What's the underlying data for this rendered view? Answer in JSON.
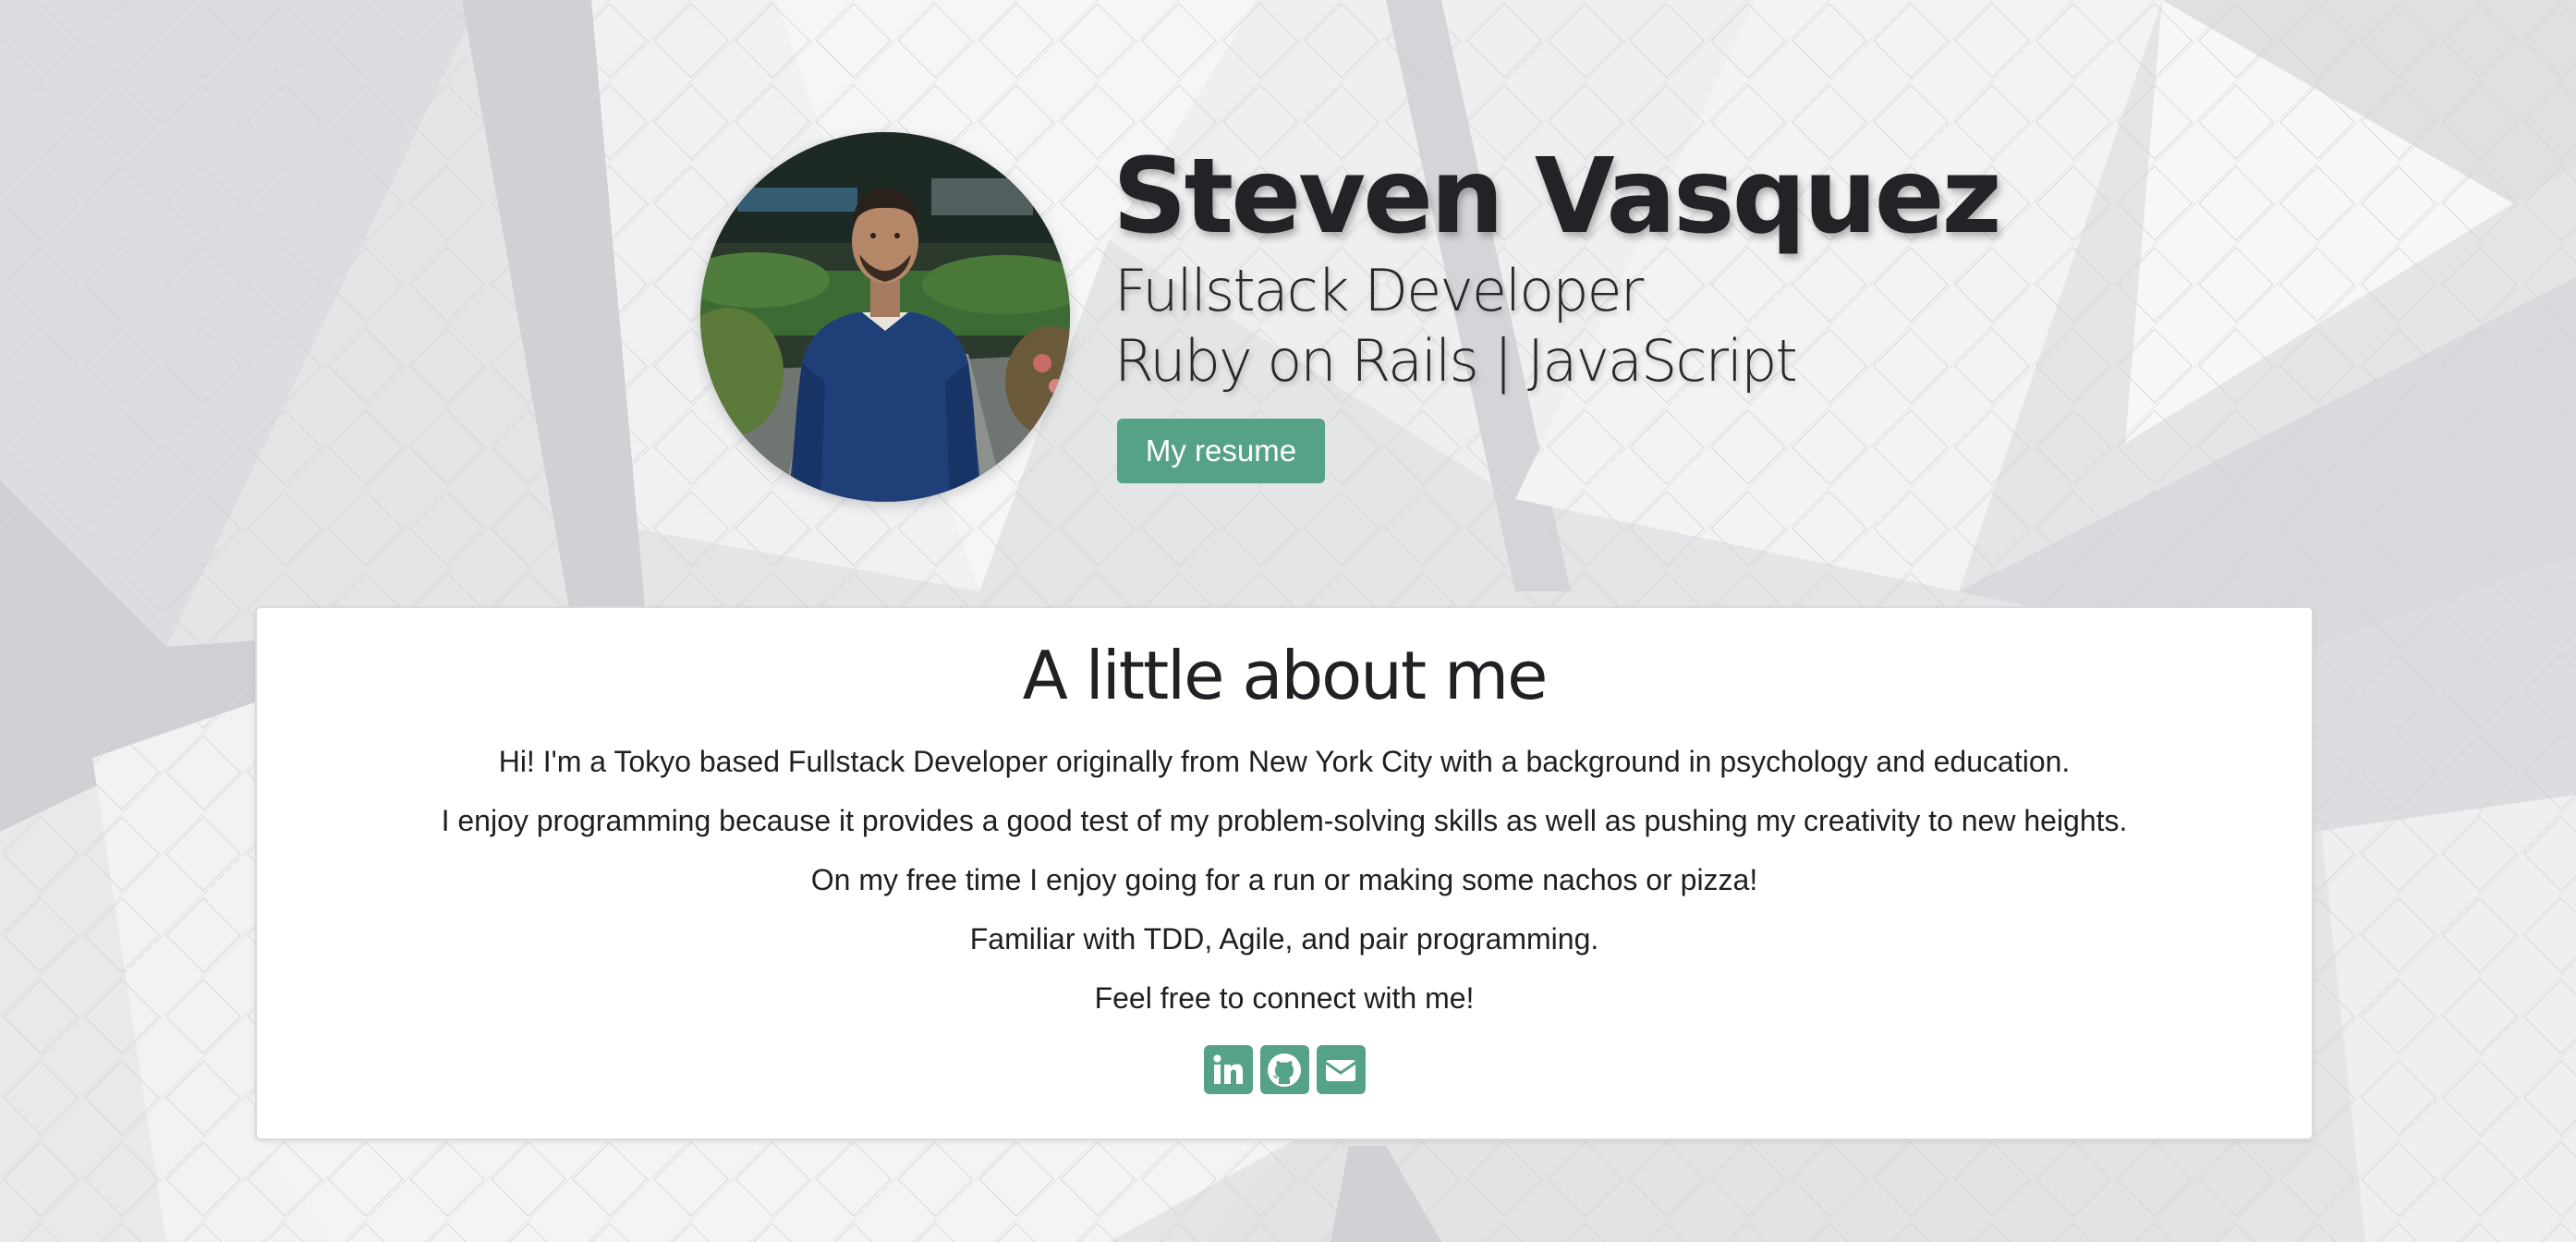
{
  "hero": {
    "name": "Steven Vasquez",
    "role": "Fullstack Developer",
    "stack": "Ruby on Rails | JavaScript",
    "resume_label": "My resume"
  },
  "about": {
    "title": "A little about me",
    "lines": [
      "Hi! I'm a Tokyo based Fullstack Developer originally from New York City with a background in psychology and education.",
      "I enjoy programming because it provides a good test of my problem-solving skills as well as pushing my creativity to new heights.",
      "On my free time I enjoy going for a run or making some nachos or pizza!",
      "Familiar with TDD, Agile, and pair programming.",
      "Feel free to connect with me!"
    ]
  },
  "social": [
    {
      "icon": "linkedin-icon"
    },
    {
      "icon": "github-icon"
    },
    {
      "icon": "email-icon"
    }
  ],
  "colors": {
    "accent": "#55a286",
    "background": "#e6e7e9",
    "card": "#ffffff",
    "text": "#222226"
  }
}
